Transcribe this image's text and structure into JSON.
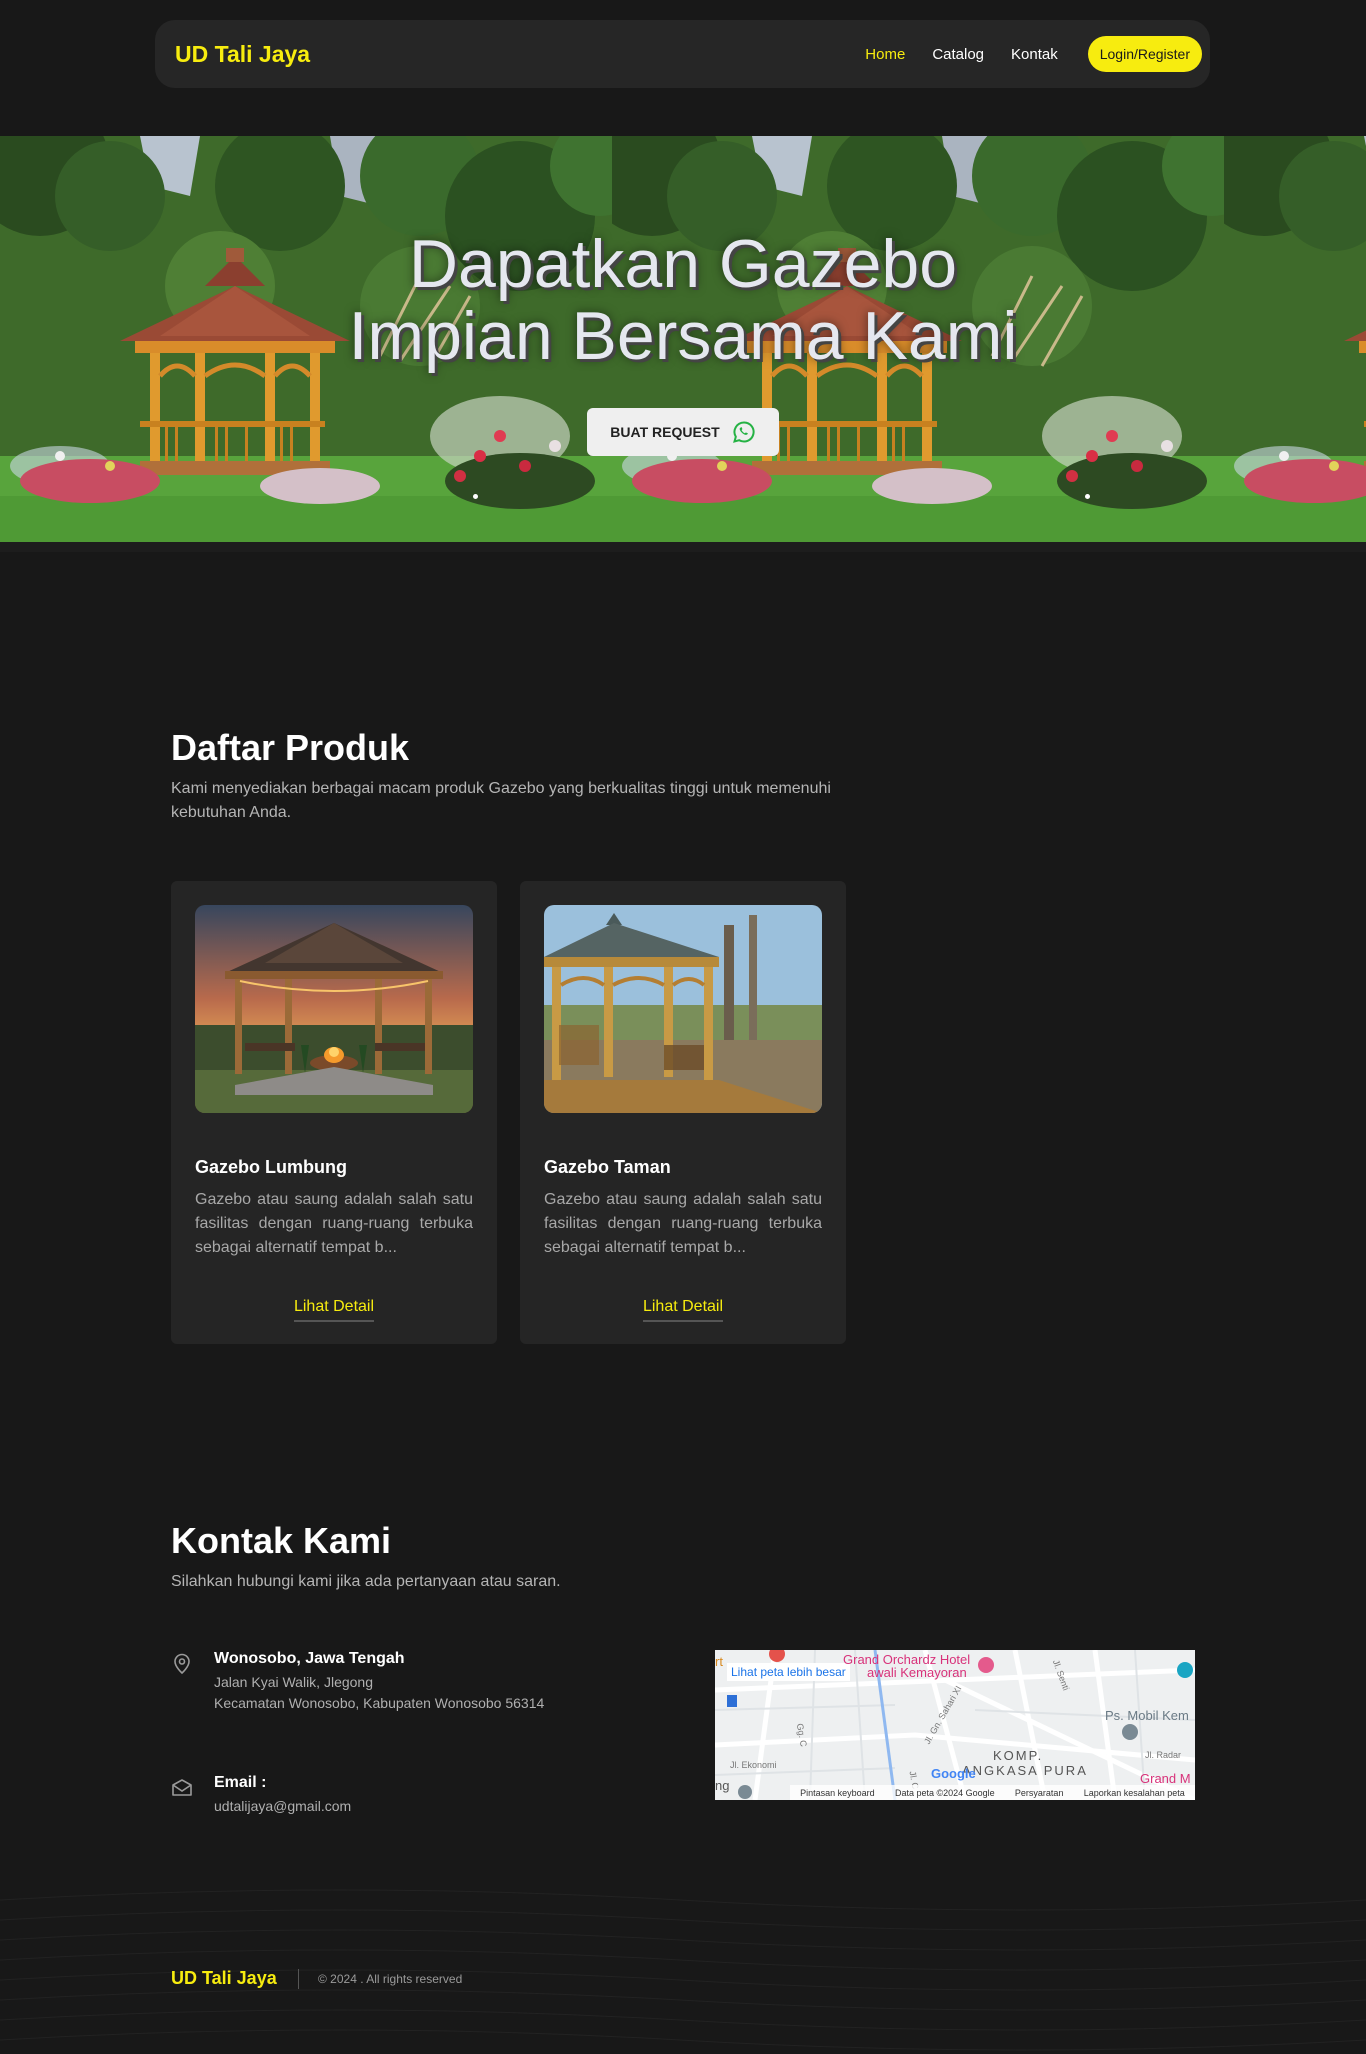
{
  "navbar": {
    "brand": "UD Tali Jaya",
    "links": [
      {
        "label": "Home",
        "active": true
      },
      {
        "label": "Catalog",
        "active": false
      },
      {
        "label": "Kontak",
        "active": false
      }
    ],
    "login_label": "Login/Register"
  },
  "hero": {
    "title_line1": "Dapatkan Gazebo",
    "title_line2": "Impian Bersama Kami",
    "request_label": "BUAT REQUEST",
    "request_icon": "whatsapp-icon"
  },
  "products": {
    "title": "Daftar Produk",
    "subtitle": "Kami menyediakan berbagai macam produk Gazebo yang berkualitas tinggi untuk memenuhi kebutuhan Anda.",
    "items": [
      {
        "name": "Gazebo Lumbung",
        "desc": "Gazebo atau saung adalah salah satu fasilitas dengan ruang-ruang terbuka sebagai alternatif tempat b...",
        "link_label": "Lihat Detail"
      },
      {
        "name": "Gazebo Taman",
        "desc": "Gazebo atau saung adalah salah satu fasilitas dengan ruang-ruang terbuka sebagai alternatif tempat b...",
        "link_label": "Lihat Detail"
      }
    ]
  },
  "contact": {
    "title": "Kontak Kami",
    "subtitle": "Silahkan hubungi kami jika ada pertanyaan atau saran.",
    "address": {
      "icon": "location-pin-icon",
      "title": "Wonosobo, Jawa Tengah",
      "line1": "Jalan Kyai Walik, Jlegong",
      "line2": "Kecamatan Wonosobo, Kabupaten Wonosobo 56314"
    },
    "email": {
      "icon": "envelope-icon",
      "title": "Email :",
      "value": "udtalijaya@gmail.com"
    },
    "map": {
      "link_label": "Lihat peta lebih besar",
      "labels": [
        "Grand Orchardz Hotel",
        "awali Kemayoran",
        "Ps. Mobil Kem",
        "KOMP.",
        "ANGKASA PURA",
        "Grand M",
        "Jl. Ekonomi",
        "Jl. Gn. Sahari XI",
        "Jl. Senti",
        "Jl. Radar",
        "Gg. C",
        "Jl. C",
        "rt",
        "ng"
      ],
      "footer": [
        "Pintasan keyboard",
        "Data peta ©2024 Google",
        "Persyaratan",
        "Laporkan kesalahan peta"
      ],
      "google": "Google"
    }
  },
  "footer": {
    "brand": "UD Tali Jaya",
    "copyright": "© 2024 . All rights reserved"
  },
  "colors": {
    "background": "#181818",
    "accent": "#f7ec0f",
    "card": "#252525",
    "navbar": "#262626"
  }
}
